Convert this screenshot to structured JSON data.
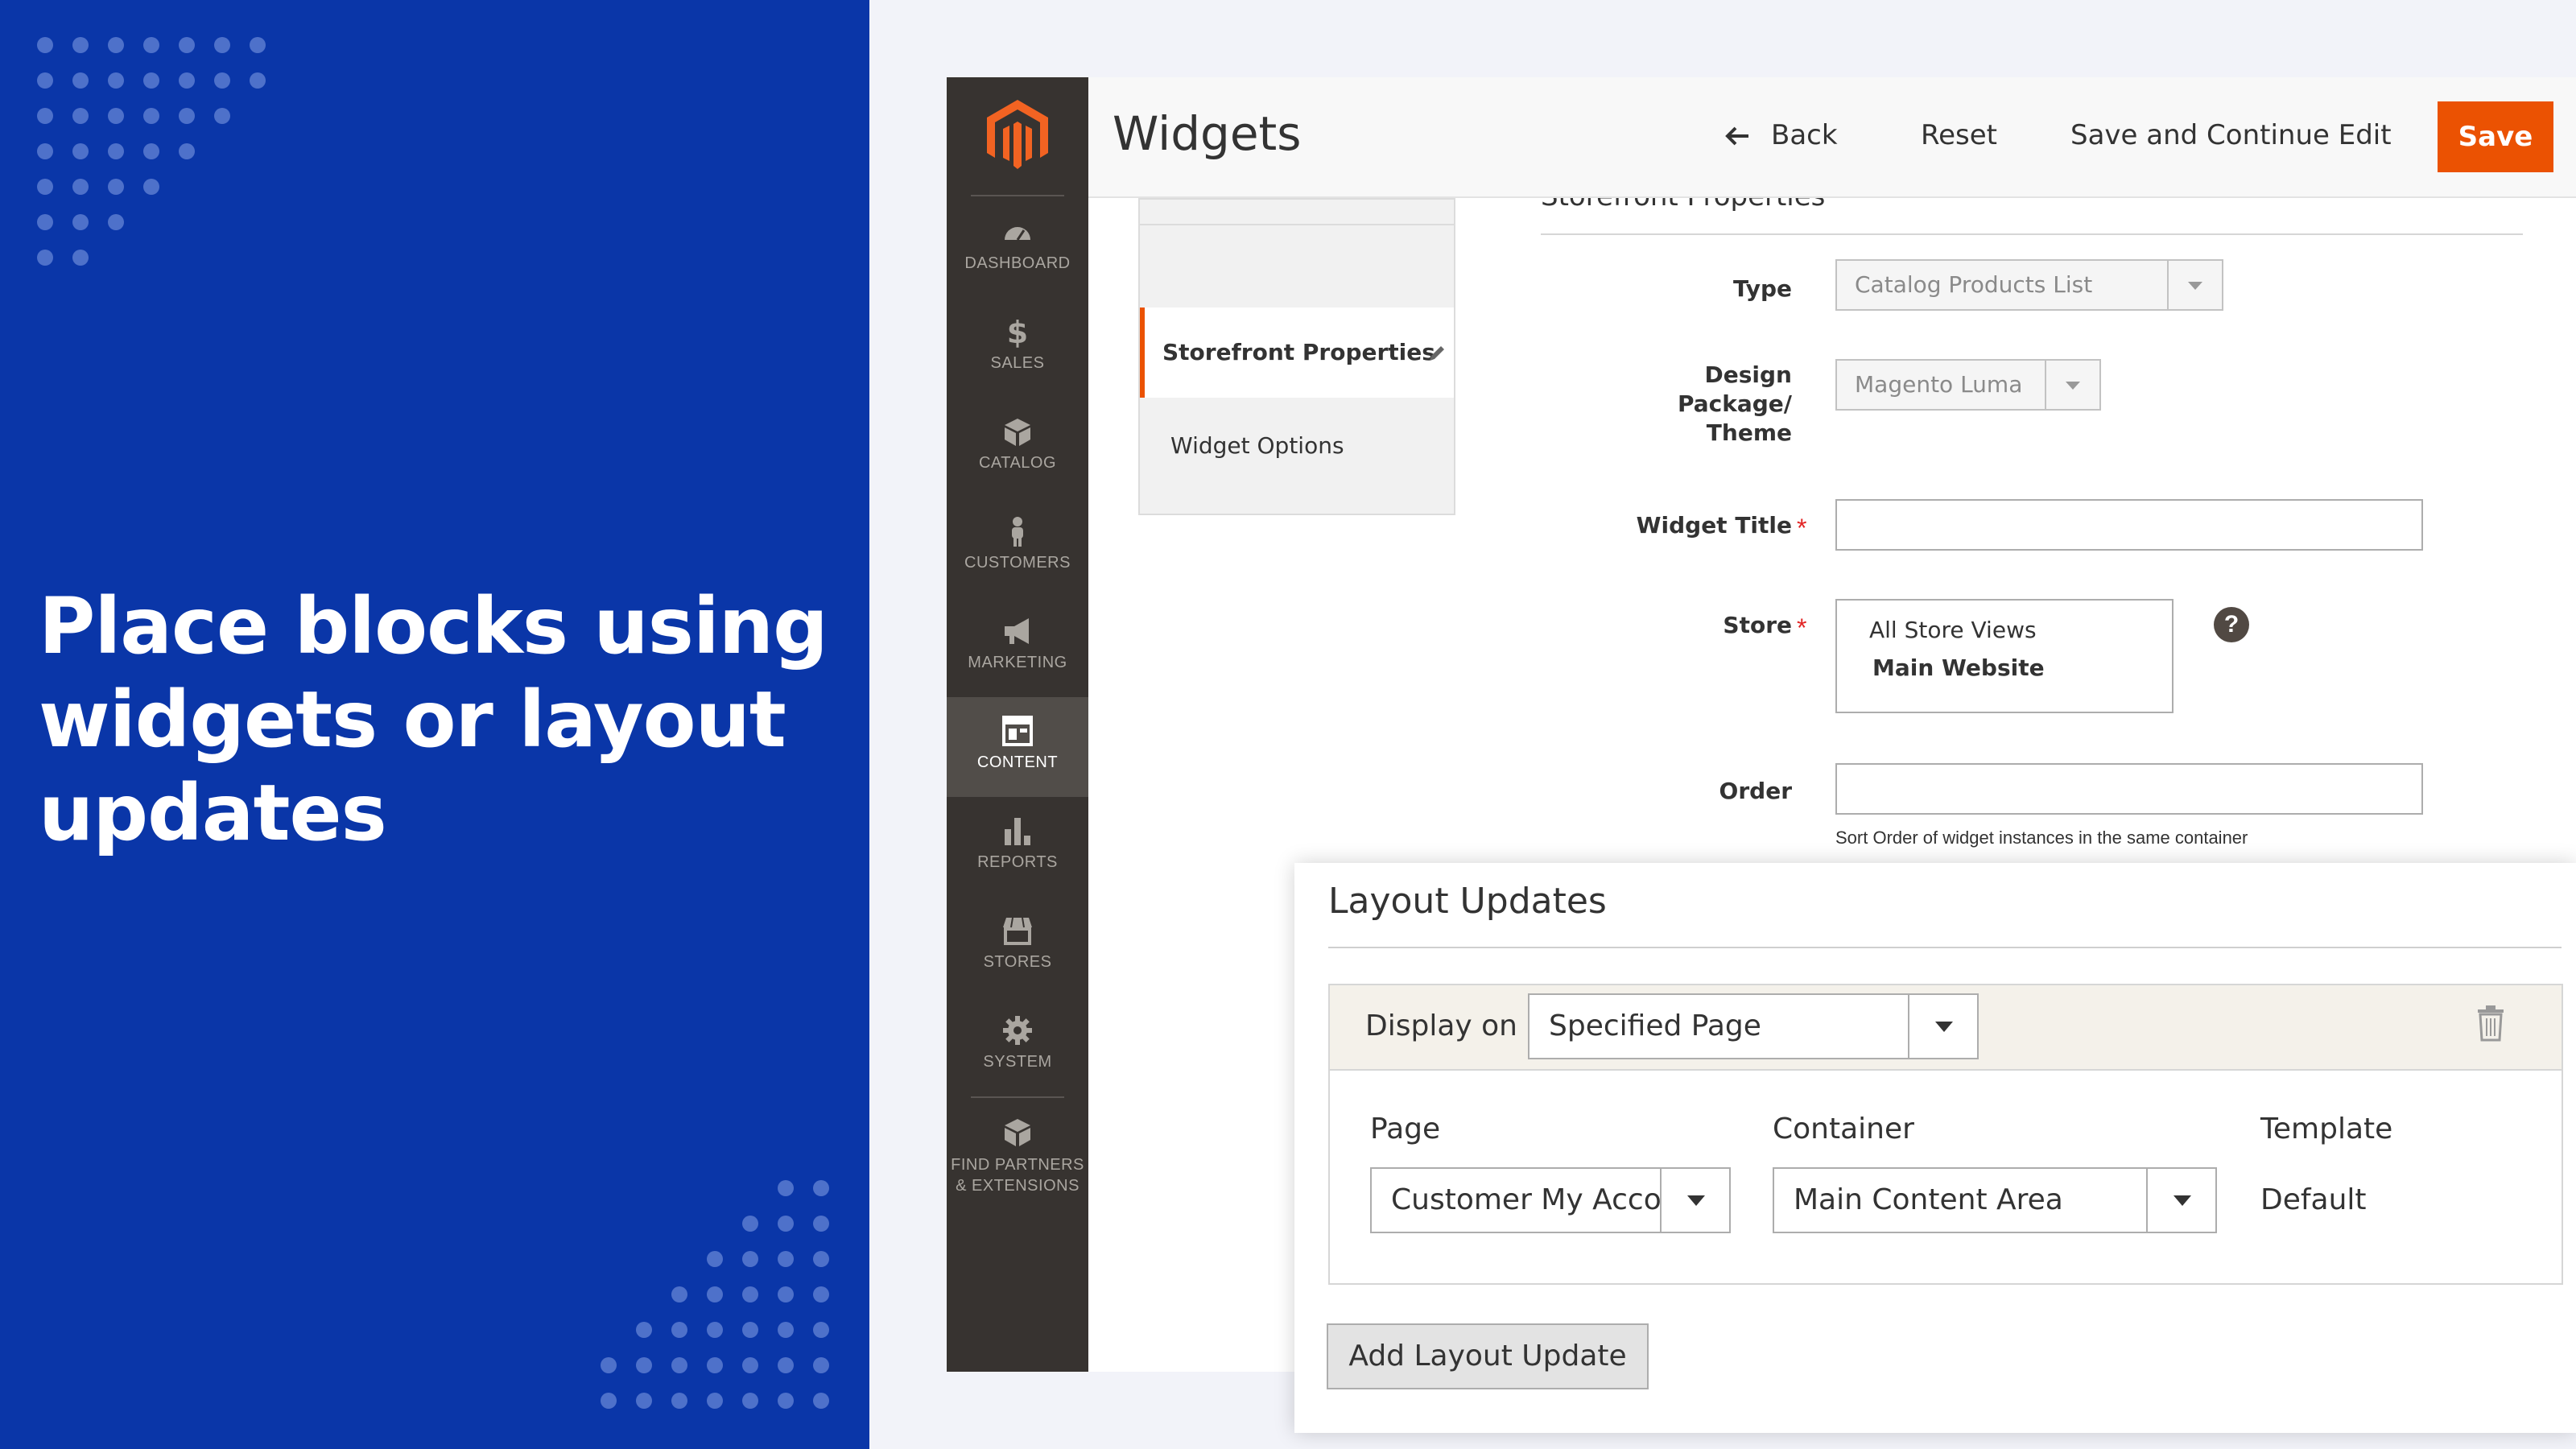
{
  "promo": {
    "headline_lines": [
      "Place blocks using",
      "widgets or layout",
      "updates"
    ]
  },
  "sidebar": {
    "items": [
      {
        "label": "DASHBOARD",
        "icon": "dashboard-icon"
      },
      {
        "label": "SALES",
        "icon": "dollar-icon"
      },
      {
        "label": "CATALOG",
        "icon": "box-icon"
      },
      {
        "label": "CUSTOMERS",
        "icon": "person-icon"
      },
      {
        "label": "MARKETING",
        "icon": "megaphone-icon"
      },
      {
        "label": "CONTENT",
        "icon": "layout-icon",
        "active": true
      },
      {
        "label": "REPORTS",
        "icon": "bar-chart-icon"
      },
      {
        "label": "STORES",
        "icon": "storefront-icon"
      },
      {
        "label": "SYSTEM",
        "icon": "gear-icon"
      },
      {
        "label": "FIND PARTNERS & EXTENSIONS",
        "icon": "extensions-icon"
      }
    ]
  },
  "header": {
    "title": "Widgets",
    "back_label": "Back",
    "reset_label": "Reset",
    "save_continue_label": "Save and Continue Edit",
    "save_label": "Save"
  },
  "tabs": {
    "storefront": "Storefront Properties",
    "widget_options": "Widget Options"
  },
  "form": {
    "section_title": "Storefront Properties",
    "type_label": "Type",
    "type_value": "Catalog Products List",
    "theme_label_lines": [
      "Design",
      "Package/",
      "Theme"
    ],
    "theme_value": "Magento Luma",
    "widget_title_label": "Widget Title",
    "store_label": "Store",
    "store_options": [
      "All Store Views",
      "Main Website"
    ],
    "order_label": "Order",
    "order_note": "Sort Order of widget instances in the same container"
  },
  "layout_updates": {
    "title": "Layout Updates",
    "display_on_label": "Display on",
    "display_on_value": "Specified Page",
    "page_label": "Page",
    "page_value": "Customer My Acco",
    "container_label": "Container",
    "container_value": "Main Content Area",
    "template_label": "Template",
    "template_value": "Default",
    "add_button": "Add Layout Update"
  },
  "colors": {
    "promo_bg": "#0a36a8",
    "sidebar_bg": "#373330",
    "accent": "#eb5202"
  }
}
